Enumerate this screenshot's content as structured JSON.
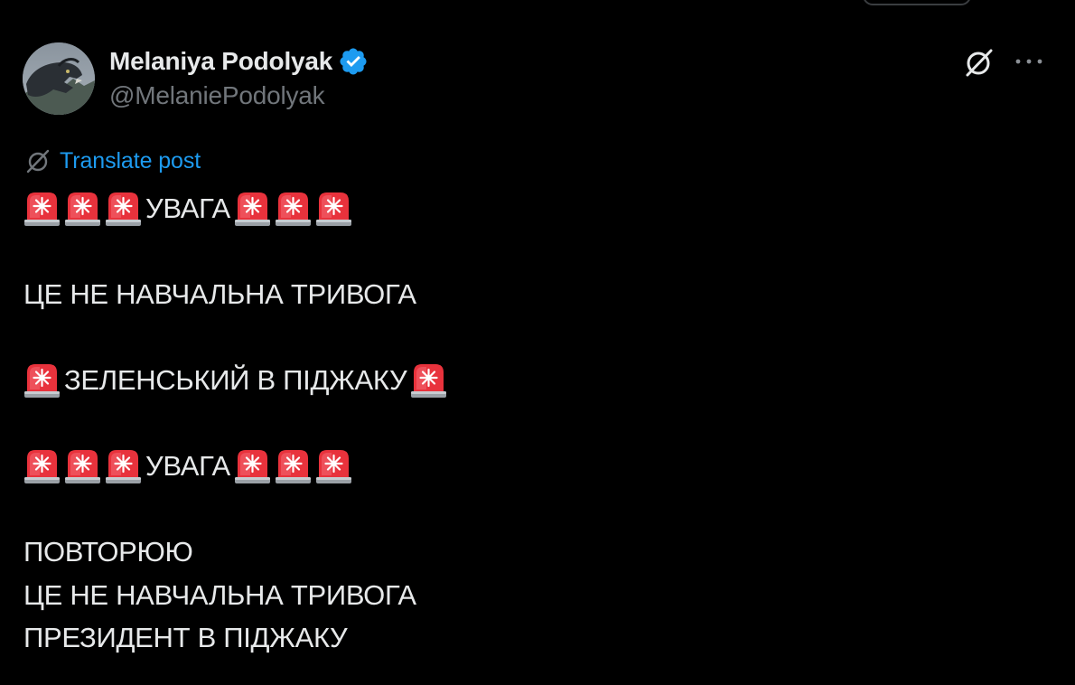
{
  "post": {
    "author_name": "Melaniya Podolyak",
    "author_handle": "@MelaniePodolyak",
    "verified": true,
    "translate_label": "Translate post",
    "lines": [
      {
        "pre_sirens": 3,
        "text": "УВАГА",
        "post_sirens": 3
      },
      {
        "pre_sirens": 0,
        "text": "",
        "post_sirens": 0
      },
      {
        "pre_sirens": 0,
        "text": "ЦЕ НЕ НАВЧАЛЬНА ТРИВОГА",
        "post_sirens": 0
      },
      {
        "pre_sirens": 0,
        "text": "",
        "post_sirens": 0
      },
      {
        "pre_sirens": 1,
        "text": "ЗЕЛЕНСЬКИЙ В ПІДЖАКУ",
        "post_sirens": 1
      },
      {
        "pre_sirens": 0,
        "text": "",
        "post_sirens": 0
      },
      {
        "pre_sirens": 3,
        "text": "УВАГА",
        "post_sirens": 3
      },
      {
        "pre_sirens": 0,
        "text": "",
        "post_sirens": 0
      },
      {
        "pre_sirens": 0,
        "text": "ПОВТОРЮЮ",
        "post_sirens": 0
      },
      {
        "pre_sirens": 0,
        "text": "ЦЕ НЕ НАВЧАЛЬНА ТРИВОГА",
        "post_sirens": 0
      },
      {
        "pre_sirens": 0,
        "text": "ПРЕЗИДЕНТ В ПІДЖАКУ",
        "post_sirens": 0
      }
    ]
  },
  "icons": {
    "verified": "verified-badge-icon",
    "grok": "grok-icon",
    "more": "more-options-icon",
    "translate": "translate-icon",
    "siren": "police-car-light-emoji"
  },
  "colors": {
    "background": "#000000",
    "text_primary": "#e7e9ea",
    "text_secondary": "#71767b",
    "accent": "#1d9bf0",
    "siren_red": "#e8323c"
  }
}
